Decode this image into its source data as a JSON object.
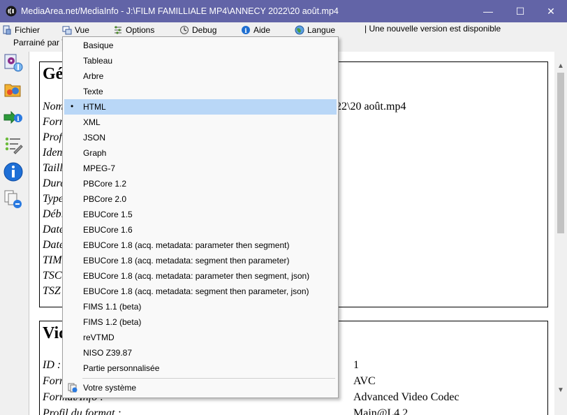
{
  "window": {
    "title": "MediaArea.net/MediaInfo - J:\\FILM FAMILLIALE MP4\\ANNECY 2022\\20 août.mp4",
    "minimize": "—",
    "maximize": "☐",
    "close": "✕"
  },
  "menu": {
    "file": "Fichier",
    "view": "Vue",
    "options": "Options",
    "debug": "Debug",
    "help": "Aide",
    "language": "Langue",
    "update_notice": "| Une nouvelle version est disponible",
    "sponsor": "Parrainé par V"
  },
  "content": {
    "general_heading": "Gé",
    "general_rows": [
      "Nom",
      "Forn",
      "Prof",
      "Iden",
      "Taill",
      "Dure",
      "Type",
      "Débi",
      "Date",
      "Date",
      "TIM",
      "TSC",
      "TSZ"
    ],
    "general_filename_tail": "22\\20 août.mp4",
    "video_heading": "Vid",
    "video_rows": [
      {
        "label": "ID :",
        "value": "1"
      },
      {
        "label": "Form",
        "value": "AVC"
      },
      {
        "label": "Format/Info :",
        "value": "Advanced Video Codec"
      },
      {
        "label": "Profil du format :",
        "value": "Main@L4.2"
      }
    ]
  },
  "dropdown": {
    "items": [
      "Basique",
      "Tableau",
      "Arbre",
      "Texte",
      "HTML",
      "XML",
      "JSON",
      "Graph",
      "MPEG-7",
      "PBCore 1.2",
      "PBCore 2.0",
      "EBUCore 1.5",
      "EBUCore 1.6",
      "EBUCore 1.8 (acq. metadata: parameter then segment)",
      "EBUCore 1.8 (acq. metadata: segment then parameter)",
      "EBUCore 1.8 (acq. metadata: parameter then segment, json)",
      "EBUCore 1.8 (acq. metadata: segment then parameter, json)",
      "FIMS 1.1 (beta)",
      "FIMS 1.2 (beta)",
      "reVTMD",
      "NISO Z39.87",
      "Partie personnalisée"
    ],
    "selected_index": 4,
    "bullet": "•",
    "system_item": "Votre système"
  },
  "scrollbar": {
    "up": "▲",
    "down": "▼"
  },
  "colors": {
    "titlebar": "#6264a7",
    "selected": "#b9d7f7"
  }
}
